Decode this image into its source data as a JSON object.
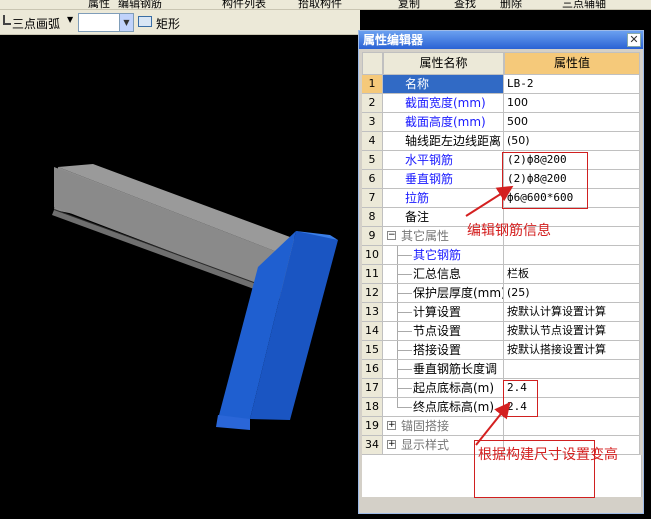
{
  "toolbar_top": {
    "items": [
      "属性",
      "编辑钢筋",
      "构件列表",
      "拾取构件",
      "复制",
      "查找",
      "删除",
      "三点辅轴"
    ]
  },
  "toolbar": {
    "arc_label": "三点画弧",
    "select_value": "",
    "rect_label": "矩形"
  },
  "panel": {
    "title": "属性编辑器",
    "col_name": "属性名称",
    "col_value": "属性值",
    "rows": [
      {
        "num": "1",
        "name": "名称",
        "value": "LB-2"
      },
      {
        "num": "2",
        "name": "截面宽度(mm)",
        "value": "100"
      },
      {
        "num": "3",
        "name": "截面高度(mm)",
        "value": "500"
      },
      {
        "num": "4",
        "name": "轴线距左边线距离",
        "value": "(50)"
      },
      {
        "num": "5",
        "name": "水平钢筋",
        "value": "(2)ф8@200"
      },
      {
        "num": "6",
        "name": "垂直钢筋",
        "value": "(2)ф8@200"
      },
      {
        "num": "7",
        "name": "拉筋",
        "value": "ф6@600*600"
      },
      {
        "num": "8",
        "name": "备注",
        "value": ""
      },
      {
        "num": "9",
        "name": "其它属性",
        "value": ""
      },
      {
        "num": "10",
        "name": "其它钢筋",
        "value": ""
      },
      {
        "num": "11",
        "name": "汇总信息",
        "value": "栏板"
      },
      {
        "num": "12",
        "name": "保护层厚度(mm)",
        "value": "(25)"
      },
      {
        "num": "13",
        "name": "计算设置",
        "value": "按默认计算设置计算"
      },
      {
        "num": "14",
        "name": "节点设置",
        "value": "按默认节点设置计算"
      },
      {
        "num": "15",
        "name": "搭接设置",
        "value": "按默认搭接设置计算"
      },
      {
        "num": "16",
        "name": "垂直钢筋长度调",
        "value": ""
      },
      {
        "num": "17",
        "name": "起点底标高(m)",
        "value": "2.4"
      },
      {
        "num": "18",
        "name": "终点底标高(m)",
        "value": "2.4"
      },
      {
        "num": "19",
        "name": "锚固搭接",
        "value": ""
      },
      {
        "num": "34",
        "name": "显示样式",
        "value": ""
      }
    ]
  },
  "annotations": {
    "rebar_note": "编辑钢筋信息",
    "elevation_note": "根据构建尺寸设置变高"
  },
  "colors": {
    "annotation_red": "#d42020",
    "header_orange": "#F5C97A",
    "selection_blue": "#316AC5",
    "beam_gray": "#9a9a9a",
    "beam_blue": "#1a5fd0"
  }
}
